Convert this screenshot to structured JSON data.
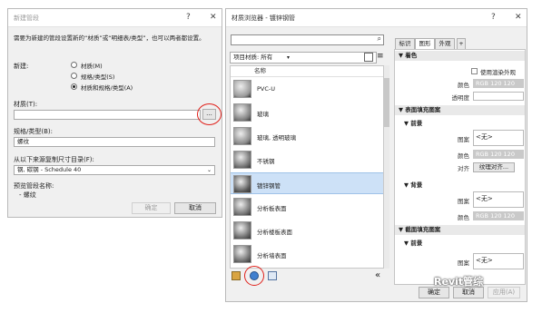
{
  "new_pipe_dialog": {
    "title": "新建管段",
    "help": "?",
    "close": "✕",
    "instruction": "需要为新建的管段设置新的“材质”或“明细表/类型”，也可以两者都设置。",
    "new_label": "新建:",
    "options": [
      "材质(M)",
      "规格/类型(S)",
      "材质和规格/类型(A)"
    ],
    "selected_option": 2,
    "material_label": "材质(T):",
    "material_value": "",
    "browse_label": "...",
    "spec_label": "规格/类型(B):",
    "spec_value": "螺纹",
    "size_catalog_label": "从以下来源复制尺寸目录(F):",
    "size_catalog_value": "钢, 碳钢 - Schedule 40",
    "preview_label": "预览管段名称:",
    "preview_value": "- 螺纹",
    "ok": "确定",
    "cancel": "取消"
  },
  "material_browser": {
    "title": "材质浏览器 - 镀锌钢管",
    "help": "?",
    "close": "✕",
    "search_placeholder": "",
    "filter_label": "项目材质: 所有",
    "list_header": "名称",
    "materials": [
      {
        "name": "PVC-U",
        "color": "#9a9a9a",
        "selected": false
      },
      {
        "name": "玻璃",
        "color": "#7d7d7d",
        "selected": false
      },
      {
        "name": "玻璃, 透明玻璃",
        "color": "#8a8a8a",
        "selected": false
      },
      {
        "name": "不锈钢",
        "color": "#6e6e6e",
        "selected": false
      },
      {
        "name": "镀锌钢管",
        "color": "#555555",
        "selected": true
      },
      {
        "name": "分析板表面",
        "color": "#707070",
        "selected": false
      },
      {
        "name": "分析楼板表面",
        "color": "#666666",
        "selected": false
      },
      {
        "name": "分析墙表面",
        "color": "#6a6a6a",
        "selected": false
      }
    ],
    "tabs": [
      "标识",
      "图形",
      "外观",
      "+"
    ],
    "active_tab": 1,
    "sections": {
      "shading": "着色",
      "use_render": "使用渲染外观",
      "color_label": "颜色",
      "color_value": "RGB 120 120 120",
      "transparency_label": "透明度",
      "surface_pattern": "表面填充图案",
      "foreground": "前景",
      "pattern_label": "图案",
      "none_value": "<无>",
      "align_label": "对齐",
      "align_value": "纹理对齐...",
      "background": "背景",
      "cut_pattern": "截面填充图案",
      "fg_color_value": "RGB 120 120 120",
      "bg_color_value": "RGB 120 120 120"
    },
    "ok": "确定",
    "cancel": "取消",
    "apply": "应用(A)",
    "collapse_label": "«"
  },
  "watermark": "Revit管综",
  "accent_red": "#e0201a",
  "selection_blue": "#cde1f7"
}
